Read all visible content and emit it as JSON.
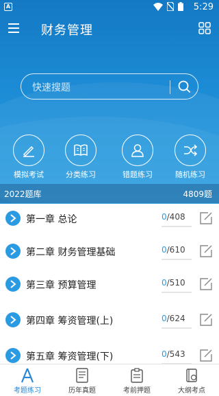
{
  "status_bar": {
    "time": "5:29",
    "badge": "A"
  },
  "app_bar": {
    "title": "财务管理"
  },
  "search": {
    "placeholder": "快速搜题"
  },
  "quick_actions": [
    {
      "label": "模拟考试",
      "icon": "pen-icon"
    },
    {
      "label": "分类练习",
      "icon": "book-icon"
    },
    {
      "label": "错题练习",
      "icon": "person-icon"
    },
    {
      "label": "随机练习",
      "icon": "shuffle-icon"
    }
  ],
  "bank": {
    "name": "2022题库",
    "total": "4809题"
  },
  "chapters": [
    {
      "title": "第一章 总论",
      "done": "0",
      "total": "/408"
    },
    {
      "title": "第二章 财务管理基础",
      "done": "0",
      "total": "/610"
    },
    {
      "title": "第三章 预算管理",
      "done": "0",
      "total": "/510"
    },
    {
      "title": "第四章 筹资管理(上)",
      "done": "0",
      "total": "/624"
    },
    {
      "title": "第五章 筹资管理(下)",
      "done": "0",
      "total": "/543"
    }
  ],
  "tabs": [
    {
      "label": "考题练习",
      "active": true
    },
    {
      "label": "历年真题",
      "active": false
    },
    {
      "label": "考前押题",
      "active": false
    },
    {
      "label": "大纲考点",
      "active": false
    }
  ],
  "colors": {
    "primary": "#1d8cd6",
    "accent": "#2a9be3",
    "tab_active": "#2a86d6"
  }
}
